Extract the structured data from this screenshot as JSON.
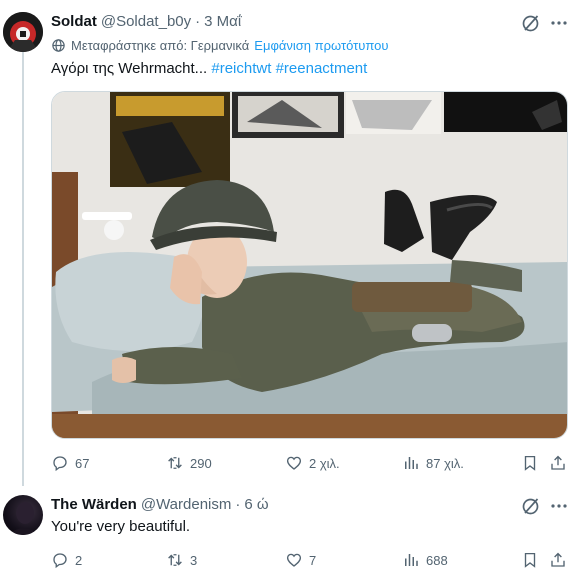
{
  "tweet1": {
    "author_name": "Soldat",
    "handle": "@Soldat_b0y",
    "time": "3 Μαΐ",
    "translated_label": "Μεταφράστηκε από: Γερμανικά",
    "show_original": "Εμφάνιση πρωτότυπου",
    "text_prefix": "Αγόρι της Wehrmacht...",
    "hashtags": [
      "#reichtwt",
      "#reenactment"
    ],
    "replies": "67",
    "reposts": "290",
    "likes": "2 χιλ.",
    "views": "87 χιλ."
  },
  "tweet2": {
    "author_name": "The Wärden",
    "handle": "@Wardenism",
    "time": "6 ώ",
    "text": "You're very beautiful.",
    "replies": "2",
    "reposts": "3",
    "likes": "7",
    "views": "688"
  },
  "colors": {
    "accent": "#1d9bf0",
    "secondary_text": "#536471",
    "primary_text": "#0f1419",
    "thread_line": "#cfd9de"
  },
  "icons": [
    "grok-icon",
    "more-icon",
    "translate-globe-icon",
    "reply-icon",
    "repost-icon",
    "like-icon",
    "views-icon",
    "bookmark-icon",
    "share-icon"
  ]
}
